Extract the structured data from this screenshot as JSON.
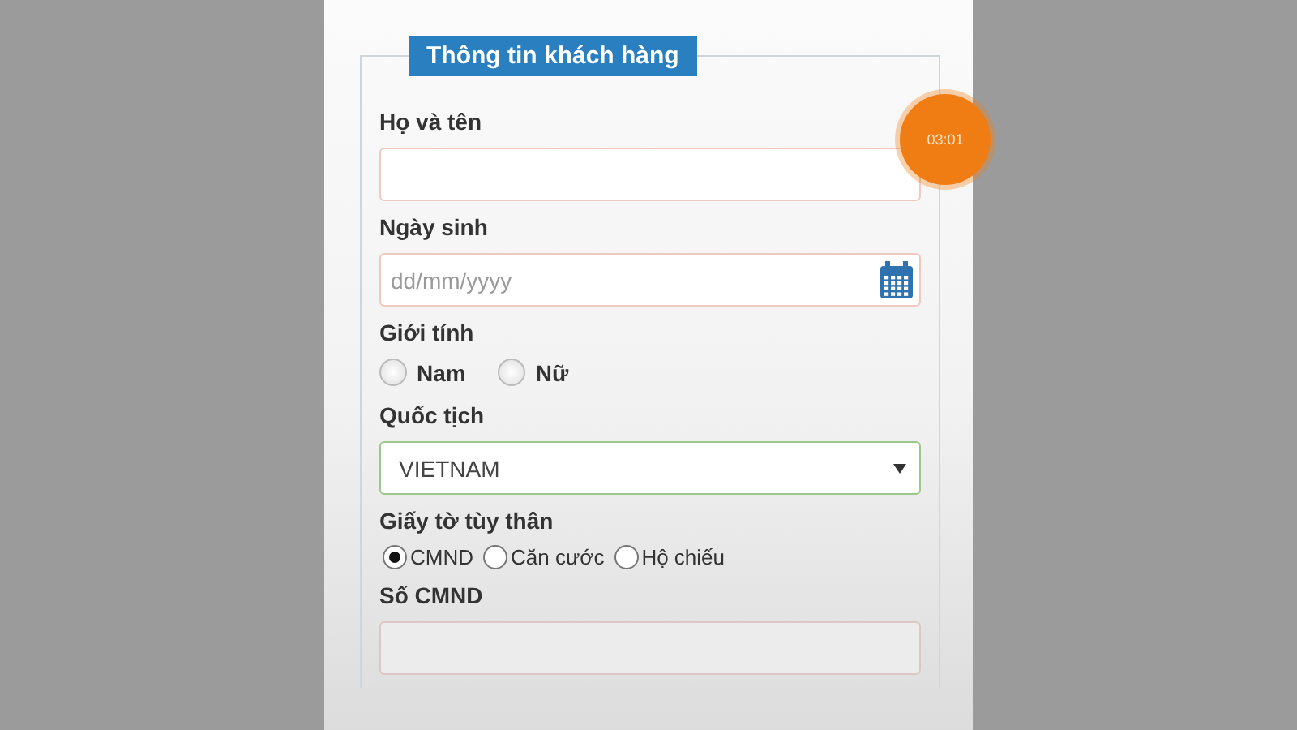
{
  "legend": "Thông tin khách hàng",
  "timer": "03:01",
  "fields": [
    {
      "kind": "text",
      "label": "Họ và tên"
    },
    {
      "kind": "date",
      "label": "Ngày sinh",
      "placeholder": "dd/mm/yyyy"
    },
    {
      "kind": "radio",
      "label": "Giới tính",
      "options": [
        {
          "label": "Nam",
          "selected": false
        },
        {
          "label": "Nữ",
          "selected": false
        }
      ]
    },
    {
      "kind": "select",
      "label": "Quốc tịch",
      "value": "VIETNAM"
    },
    {
      "kind": "radio-compact",
      "label": "Giấy tờ tùy thân",
      "options": [
        {
          "label": "CMND",
          "selected": true
        },
        {
          "label": "Căn cước",
          "selected": false
        },
        {
          "label": "Hộ chiếu",
          "selected": false
        }
      ]
    },
    {
      "kind": "readonly",
      "label": "Số CMND"
    }
  ]
}
